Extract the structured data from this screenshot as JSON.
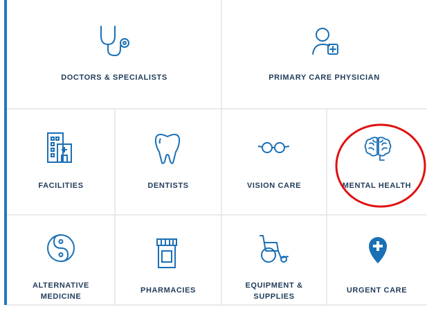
{
  "colors": {
    "accent": "#1b7bbf",
    "icon": "#1a6fb5",
    "label": "#1f3b5a",
    "divider": "#e3e3e3",
    "annotation": "#e01010"
  },
  "tiles": [
    {
      "label": "DOCTORS & SPECIALISTS",
      "icon": "stethoscope-icon"
    },
    {
      "label": "PRIMARY CARE PHYSICIAN",
      "icon": "user-plus-icon"
    },
    {
      "label": "FACILITIES",
      "icon": "building-icon"
    },
    {
      "label": "DENTISTS",
      "icon": "tooth-icon"
    },
    {
      "label": "VISION CARE",
      "icon": "glasses-icon"
    },
    {
      "label": "MENTAL HEALTH",
      "icon": "brain-icon"
    },
    {
      "label": "ALTERNATIVE\nMEDICINE",
      "icon": "yin-yang-icon"
    },
    {
      "label": "PHARMACIES",
      "icon": "pill-bottle-icon"
    },
    {
      "label": "EQUIPMENT &\nSUPPLIES",
      "icon": "wheelchair-icon"
    },
    {
      "label": "URGENT CARE",
      "icon": "location-plus-icon"
    }
  ]
}
